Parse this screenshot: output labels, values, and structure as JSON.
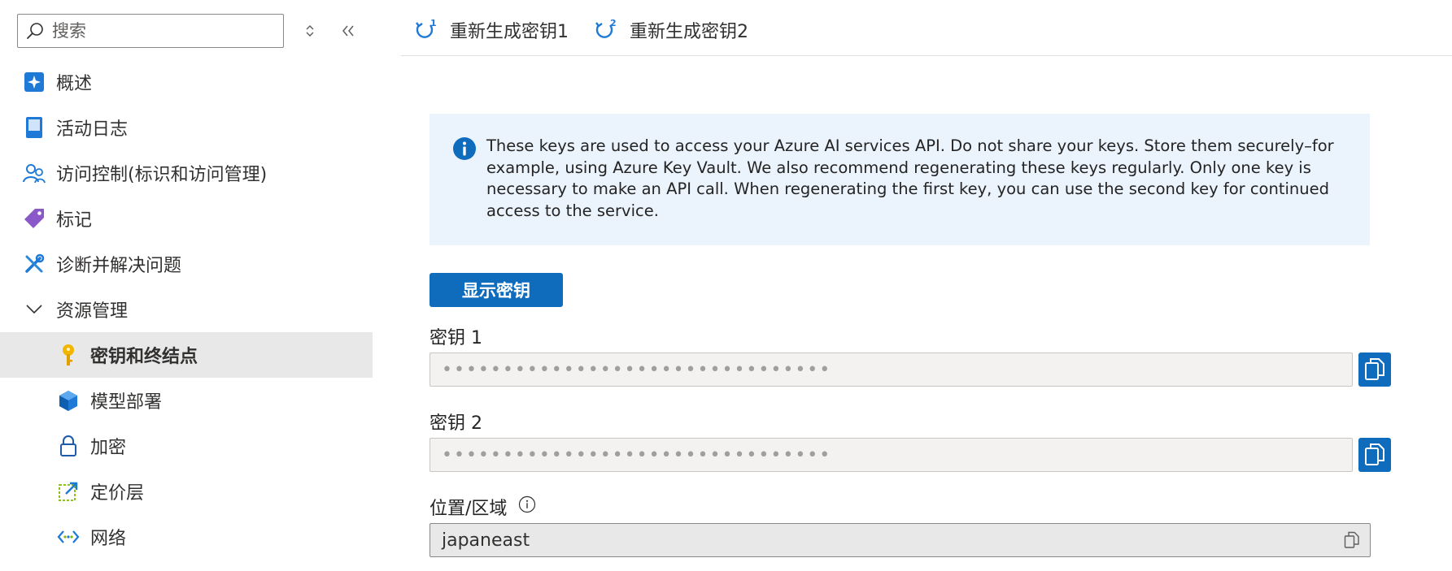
{
  "search": {
    "placeholder": "搜索"
  },
  "sidebar": {
    "items": [
      {
        "label": "概述",
        "icon": "overview-icon"
      },
      {
        "label": "活动日志",
        "icon": "activity-log-icon"
      },
      {
        "label": "访问控制(标识和访问管理)",
        "icon": "access-control-icon"
      },
      {
        "label": "标记",
        "icon": "tag-icon"
      },
      {
        "label": "诊断并解决问题",
        "icon": "diagnose-icon"
      },
      {
        "label": "资源管理",
        "icon": "chevron-down-icon"
      },
      {
        "label": "密钥和终结点",
        "icon": "key-icon",
        "selected": true
      },
      {
        "label": "模型部署",
        "icon": "model-deploy-icon"
      },
      {
        "label": "加密",
        "icon": "lock-icon"
      },
      {
        "label": "定价层",
        "icon": "pricing-tier-icon"
      },
      {
        "label": "网络",
        "icon": "network-icon"
      }
    ]
  },
  "toolbar": {
    "regen_key1": "重新生成密钥1",
    "regen_key2": "重新生成密钥2"
  },
  "info": {
    "text": "These keys are used to access your Azure AI services API. Do not share your keys. Store them securely–for example, using Azure Key Vault. We also recommend regenerating these keys regularly. Only one key is necessary to make an API call. When regenerating the first key, you can use the second key for continued access to the service."
  },
  "show_keys_label": "显示密钥",
  "key1": {
    "label": "密钥 1",
    "value": "••••••••••••••••••••••••••••••••"
  },
  "key2": {
    "label": "密钥 2",
    "value": "••••••••••••••••••••••••••••••••"
  },
  "region": {
    "label": "位置/区域",
    "value": "japaneast"
  },
  "colors": {
    "accent": "#0f6cbd",
    "info_bg": "#ebf3fc",
    "selected_bg": "#e8e8e8"
  }
}
